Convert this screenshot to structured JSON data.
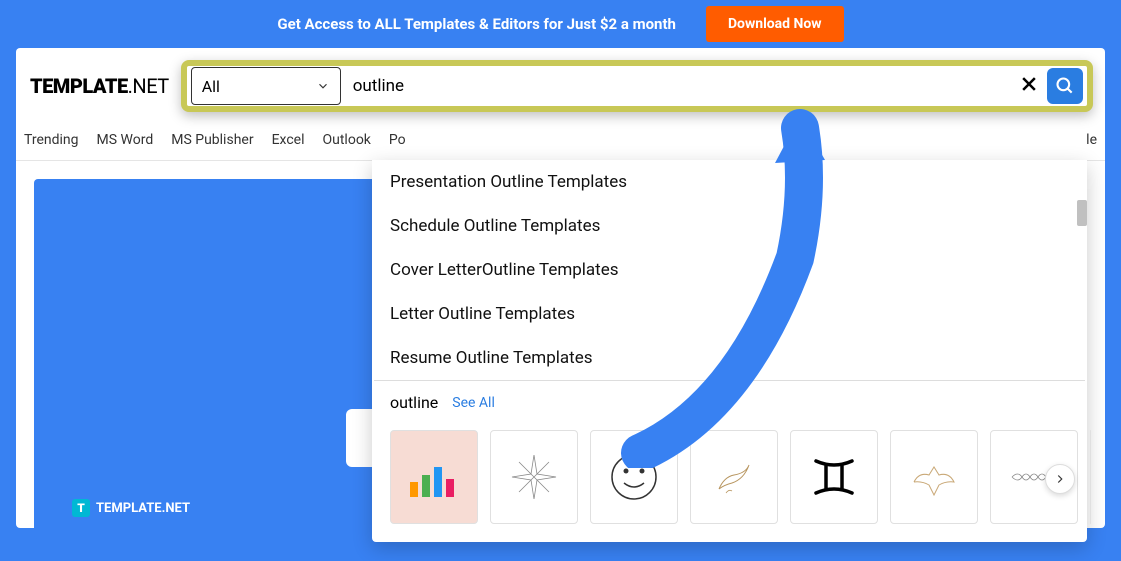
{
  "banner": {
    "text": "Get Access to ALL Templates & Editors for Just $2 a month",
    "cta": "Download Now"
  },
  "logo": {
    "brand": "TEMPLATE",
    "suffix": ".NET"
  },
  "search": {
    "category": "All",
    "value": "outline",
    "placeholder": ""
  },
  "nav": [
    "Trending",
    "MS Word",
    "MS Publisher",
    "Excel",
    "Outlook",
    "Po"
  ],
  "nav_right": "le",
  "suggestions": [
    "Presentation Outline Templates",
    "Schedule Outline Templates",
    "Cover LetterOutline Templates",
    "Letter Outline Templates",
    "Resume Outline Templates"
  ],
  "results": {
    "title": "outline",
    "see_all": "See All"
  },
  "footer_logo": "TEMPLATE.NET"
}
